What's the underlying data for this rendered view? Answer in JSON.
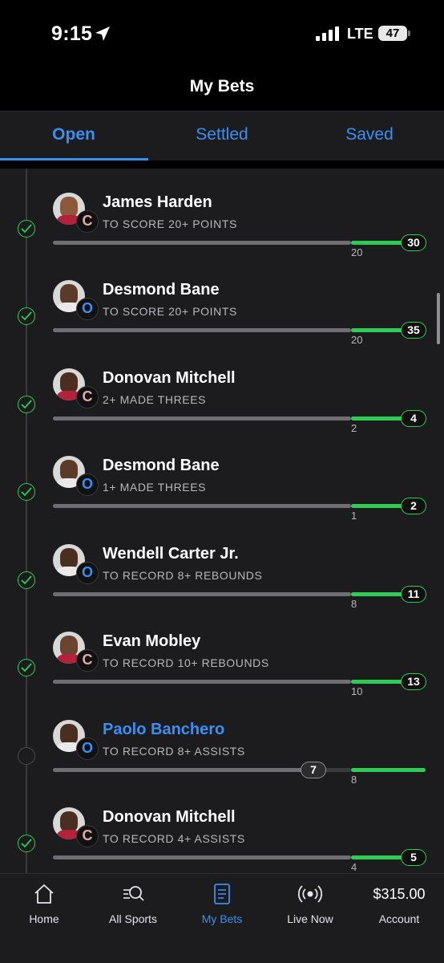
{
  "status": {
    "time": "9:15",
    "network": "LTE",
    "battery": "47"
  },
  "header": {
    "title": "My Bets"
  },
  "tabs": [
    {
      "label": "Open"
    },
    {
      "label": "Settled"
    },
    {
      "label": "Saved"
    }
  ],
  "bets": [
    {
      "player": "James Harden",
      "market": "TO SCORE 20+ POINTS",
      "line": "20",
      "current": "30",
      "logo": "C"
    },
    {
      "player": "Desmond Bane",
      "market": "TO SCORE 20+ POINTS",
      "line": "20",
      "current": "35",
      "logo": "O"
    },
    {
      "player": "Donovan Mitchell",
      "market": "2+ MADE THREES",
      "line": "2",
      "current": "4",
      "logo": "C"
    },
    {
      "player": "Desmond Bane",
      "market": "1+ MADE THREES",
      "line": "1",
      "current": "2",
      "logo": "O"
    },
    {
      "player": "Wendell Carter Jr.",
      "market": "TO RECORD 8+ REBOUNDS",
      "line": "8",
      "current": "11",
      "logo": "O"
    },
    {
      "player": "Evan Mobley",
      "market": "TO RECORD 10+ REBOUNDS",
      "line": "10",
      "current": "13",
      "logo": "C"
    },
    {
      "player": "Paolo Banchero",
      "market": "TO RECORD 8+ ASSISTS",
      "line": "8",
      "current": "7",
      "logo": "O"
    },
    {
      "player": "Donovan Mitchell",
      "market": "TO RECORD 4+ ASSISTS",
      "line": "4",
      "current": "5",
      "logo": "C"
    }
  ],
  "nav": {
    "home": "Home",
    "all_sports": "All Sports",
    "my_bets": "My Bets",
    "live_now": "Live Now",
    "account": "Account",
    "balance": "$315.00"
  },
  "colors": {
    "accent": "#3b8ff3",
    "success": "#2ecc55",
    "background": "#1c1c1e"
  }
}
